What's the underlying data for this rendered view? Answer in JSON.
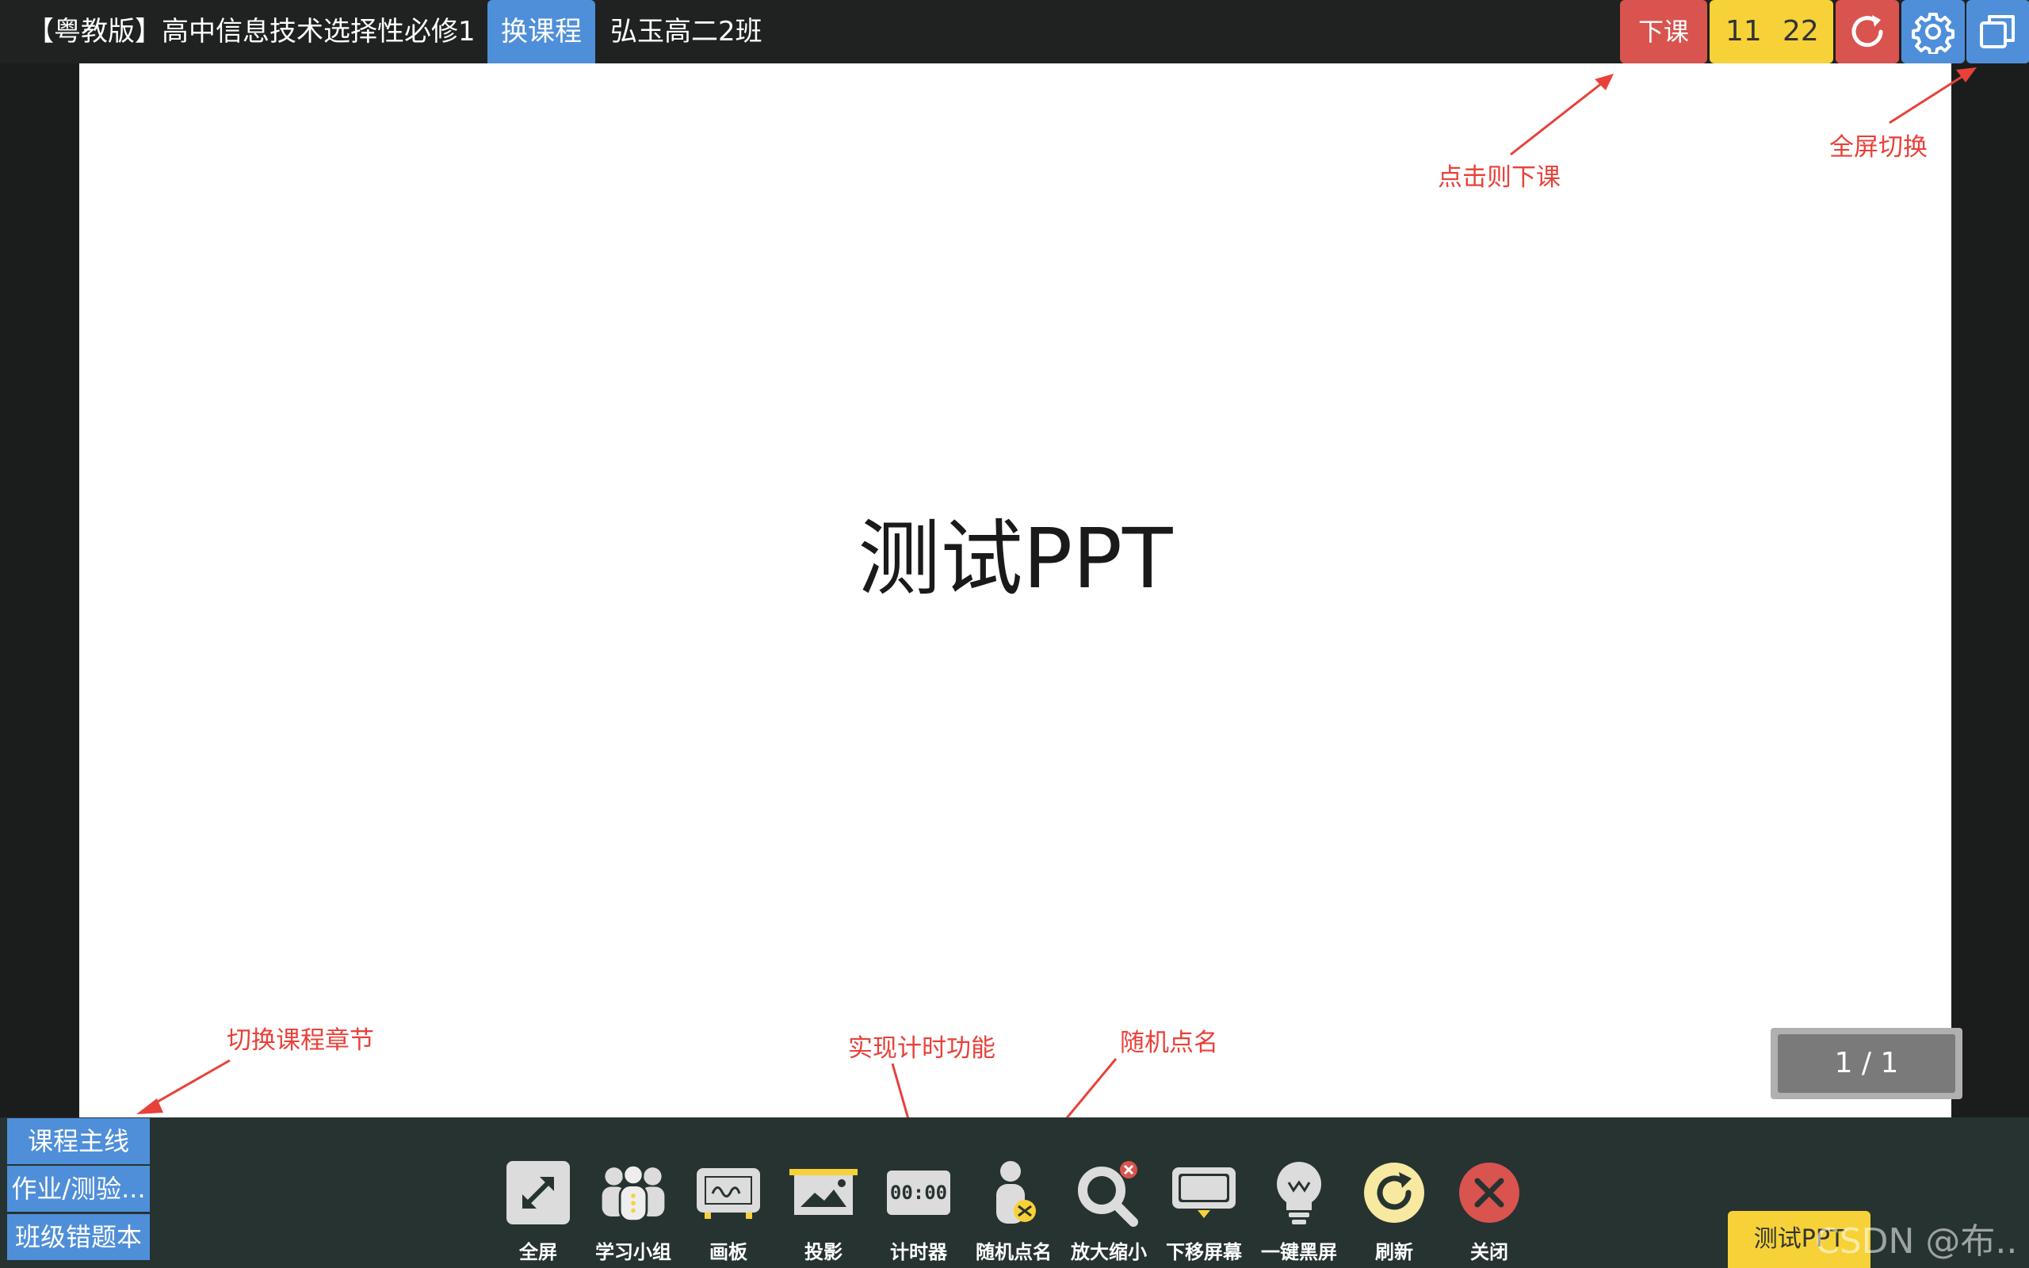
{
  "topbar": {
    "course_title": "【粤教版】高中信息技术选择性必修1",
    "switch_course_label": "换课程",
    "class_name": "弘玉高二2班",
    "end_class_label": "下课",
    "timer_minutes": "11",
    "timer_seconds": "22",
    "icons": [
      "reload-icon",
      "gear-icon",
      "window-toggle-icon"
    ]
  },
  "slide": {
    "title": "测试PPT",
    "page_indicator": "1 / 1"
  },
  "annotations": {
    "end_class": "点击则下课",
    "fullscreen": "全屏切换",
    "switch_chapter": "切换课程章节",
    "timer": "实现计时功能",
    "random_call": "随机点名"
  },
  "sidebar": {
    "tabs": [
      "课程主线",
      "作业/测验...",
      "班级错题本"
    ]
  },
  "toolbar": {
    "items": [
      {
        "label": "全屏",
        "icon": "expand-icon"
      },
      {
        "label": "学习小组",
        "icon": "group-icon"
      },
      {
        "label": "画板",
        "icon": "drawing-board-icon"
      },
      {
        "label": "投影",
        "icon": "projector-icon"
      },
      {
        "label": "计时器",
        "icon": "timer-icon",
        "display": "00:00"
      },
      {
        "label": "随机点名",
        "icon": "random-person-icon"
      },
      {
        "label": "放大缩小",
        "icon": "magnifier-icon"
      },
      {
        "label": "下移屏幕",
        "icon": "screen-down-icon"
      },
      {
        "label": "一键黑屏",
        "icon": "lightbulb-icon"
      },
      {
        "label": "刷新",
        "icon": "refresh-icon"
      },
      {
        "label": "关闭",
        "icon": "close-icon"
      }
    ]
  },
  "current_slide_tab": "测试PPT",
  "watermark": "CSDN @布..",
  "colors": {
    "blue": "#4f8fd9",
    "red": "#d9534f",
    "yellow": "#f6d238",
    "toolbar_bg": "#273331",
    "annotation": "#e8413a"
  }
}
